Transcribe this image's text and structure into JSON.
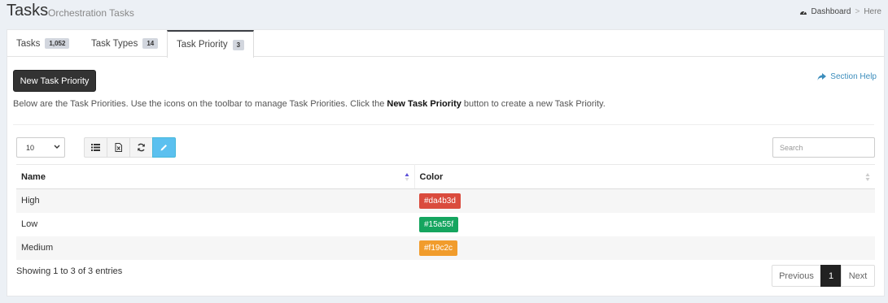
{
  "header": {
    "title": "Tasks",
    "subtitle": "Orchestration Tasks",
    "breadcrumb": {
      "home": "Dashboard",
      "separator": ">",
      "current": "Here"
    }
  },
  "tabs": [
    {
      "label": "Tasks",
      "count": "1,052",
      "active": false
    },
    {
      "label": "Task Types",
      "count": "14",
      "active": false
    },
    {
      "label": "Task Priority",
      "count": "3",
      "active": true
    }
  ],
  "actions": {
    "new_label": "New Task Priority",
    "help_label": "Section Help"
  },
  "description": {
    "before": "Below are the Task Priorities. Use the icons on the toolbar to manage Task Priorities. Click the ",
    "bold": "New Task Priority",
    "after": " button to create a new Task Priority."
  },
  "controls": {
    "page_length": "10",
    "search_placeholder": "Search",
    "toolbar_icons": [
      "list-icon",
      "excel-icon",
      "refresh-icon",
      "edit-icon"
    ]
  },
  "table": {
    "columns": [
      "Name",
      "Color"
    ],
    "rows": [
      {
        "name": "High",
        "color": "#da4b3d"
      },
      {
        "name": "Low",
        "color": "#15a55f"
      },
      {
        "name": "Medium",
        "color": "#f19c2c"
      }
    ]
  },
  "footer": {
    "info": "Showing 1 to 3 of 3 entries",
    "pagination": {
      "previous": "Previous",
      "page": "1",
      "next": "Next"
    }
  }
}
